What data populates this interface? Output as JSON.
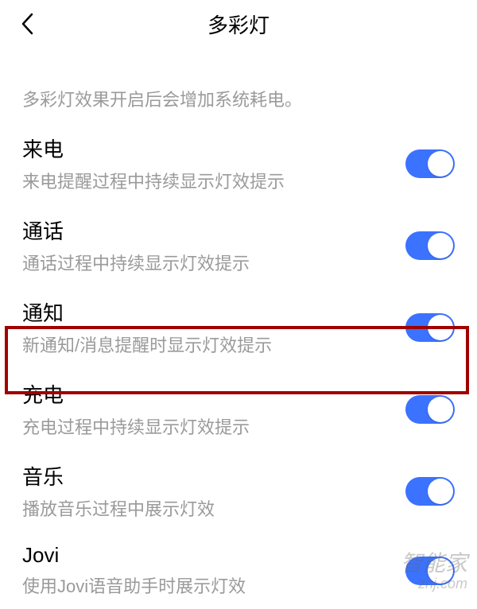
{
  "header": {
    "title": "多彩灯"
  },
  "description": "多彩灯效果开启后会增加系统耗电。",
  "settings": {
    "incoming": {
      "title": "来电",
      "subtitle": "来电提醒过程中持续显示灯效提示"
    },
    "call": {
      "title": "通话",
      "subtitle": "通话过程中持续显示灯效提示"
    },
    "notification": {
      "title": "通知",
      "subtitle": "新通知/消息提醒时显示灯效提示"
    },
    "charging": {
      "title": "充电",
      "subtitle": "充电过程中持续显示灯效提示"
    },
    "music": {
      "title": "音乐",
      "subtitle": "播放音乐过程中展示灯效"
    },
    "jovi": {
      "title": "Jovi",
      "subtitle": "使用Jovi语音助手时展示灯效"
    }
  },
  "watermark": {
    "top": "智能家",
    "bottom": "znj.com"
  }
}
